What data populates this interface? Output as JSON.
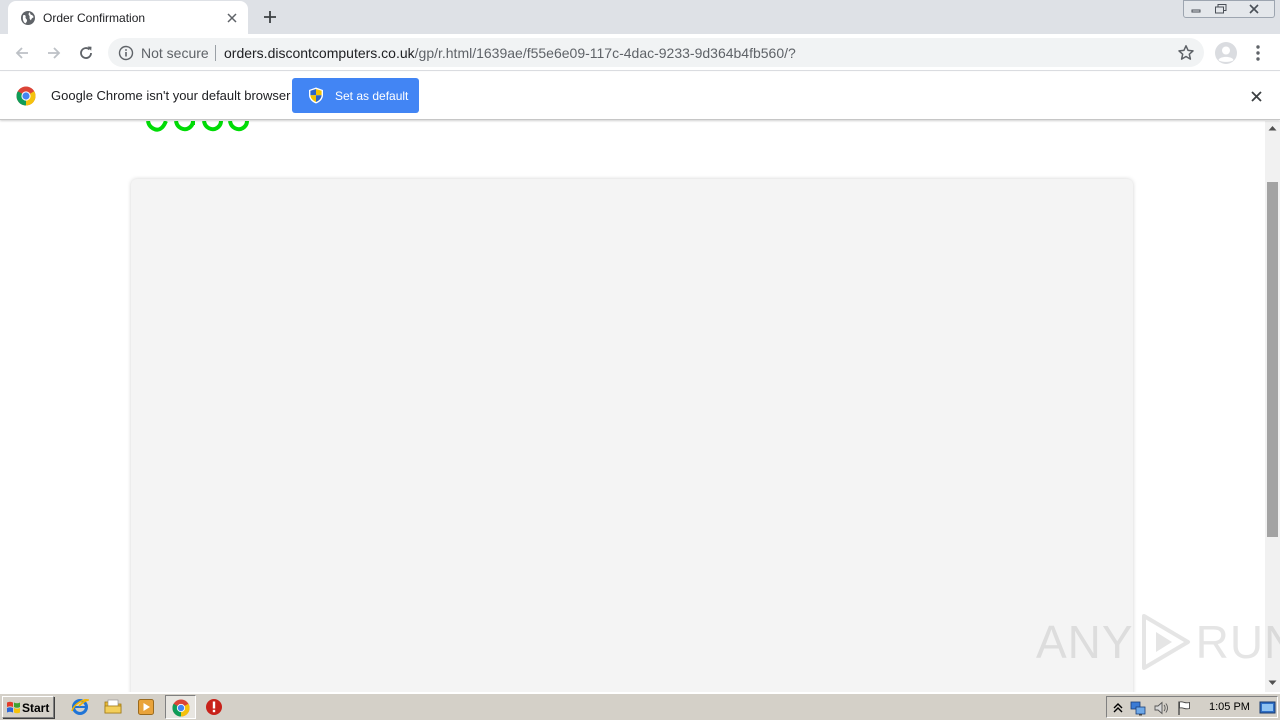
{
  "tab": {
    "title": "Order Confirmation",
    "favicon": "globe-icon"
  },
  "omnibox": {
    "security_label": "Not secure",
    "url_host": "orders.discontcomputers.co.uk",
    "url_path": "/gp/r.html/1639ae/f55e6e09-117c-4dac-9233-9d364b4fb560/?"
  },
  "infobar": {
    "message": "Google Chrome isn't your default browser",
    "button_label": "Set as default"
  },
  "watermark": {
    "left": "ANY",
    "right": "RUN"
  },
  "taskbar": {
    "start_label": "Start",
    "clock": "1:05 PM"
  },
  "colors": {
    "infobar_button": "#4285f4",
    "logo_green": "#00dc06",
    "card_bg": "#f4f4f4",
    "tabstrip_bg": "#dee1e6"
  }
}
